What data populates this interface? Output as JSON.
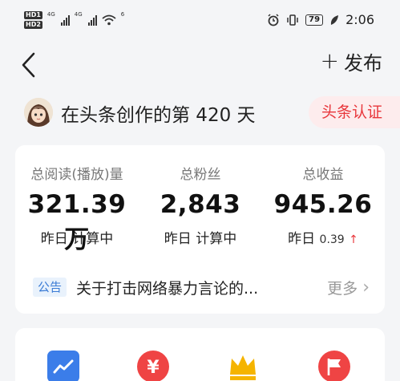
{
  "status_bar": {
    "hd1": "HD1",
    "hd2": "HD2",
    "net1": "4G",
    "net2": "4G",
    "wifi_level": "6",
    "battery": "79",
    "time": "2:06"
  },
  "nav": {
    "publish_label": "发布"
  },
  "profile": {
    "days_text": "在头条创作的第 420 天",
    "auth_label": "头条认证"
  },
  "stats": [
    {
      "label": "总阅读(播放)量",
      "value": "321.39万",
      "sub": "昨日 计算中"
    },
    {
      "label": "总粉丝",
      "value": "2,843",
      "sub": "昨日 计算中"
    },
    {
      "label": "总收益",
      "value": "945.26",
      "sub_label": "昨日",
      "sub_value": "0.39",
      "trend": "up"
    }
  ],
  "notice": {
    "tag": "公告",
    "text": "关于打击网络暴力言论的...",
    "more": "更多"
  },
  "tools": [
    {
      "icon": "trend-chart-icon",
      "color": "#3b7de9"
    },
    {
      "icon": "yuan-icon",
      "color": "#ef4444"
    },
    {
      "icon": "crown-icon",
      "color": "#f5b400"
    },
    {
      "icon": "flag-icon",
      "color": "#ef4444"
    }
  ],
  "colors": {
    "accent_red": "#e8363b",
    "notice_blue": "#3a7bd5",
    "background": "#f4f5f7"
  }
}
